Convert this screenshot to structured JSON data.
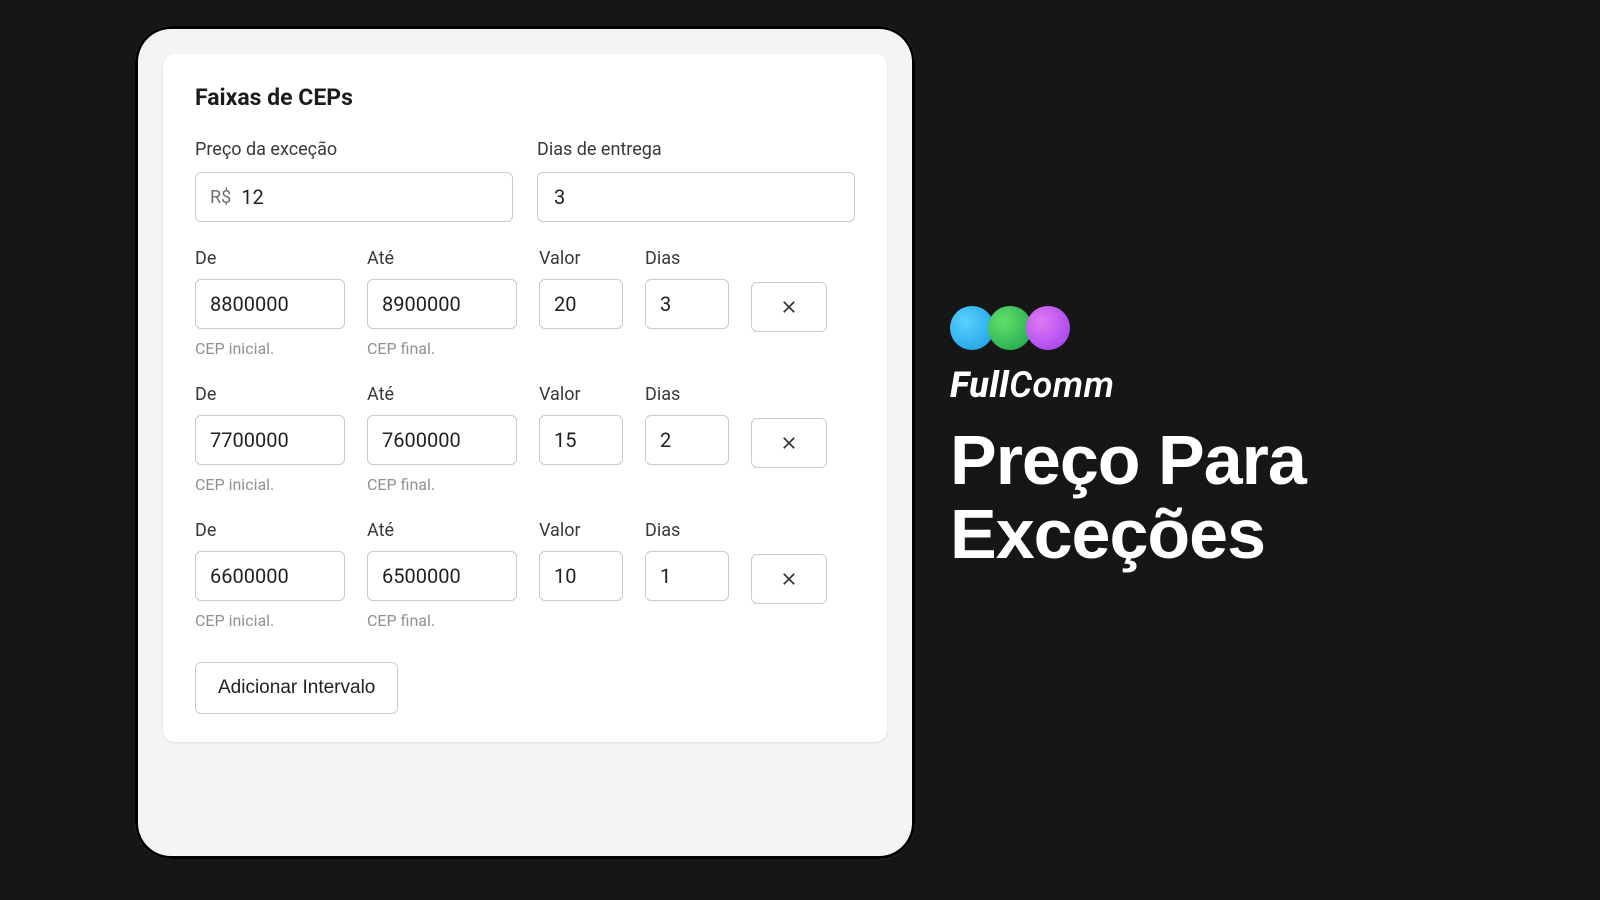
{
  "card": {
    "title": "Faixas de CEPs",
    "price_label": "Preço da exceção",
    "price_prefix": "R$",
    "price_value": "12",
    "days_label": "Dias de entrega",
    "days_value": "3",
    "col_labels": {
      "de": "De",
      "ate": "Até",
      "valor": "Valor",
      "dias": "Dias"
    },
    "hints": {
      "de": "CEP inicial.",
      "ate": "CEP final."
    },
    "rows": [
      {
        "de": "8800000",
        "ate": "8900000",
        "valor": "20",
        "dias": "3"
      },
      {
        "de": "7700000",
        "ate": "7600000",
        "valor": "15",
        "dias": "2"
      },
      {
        "de": "6600000",
        "ate": "6500000",
        "valor": "10",
        "dias": "1"
      }
    ],
    "add_button": "Adicionar Intervalo"
  },
  "right": {
    "brand_bold": "Full",
    "brand_light": "Comm",
    "headline_l1": "Preço Para",
    "headline_l2": "Exceções"
  }
}
